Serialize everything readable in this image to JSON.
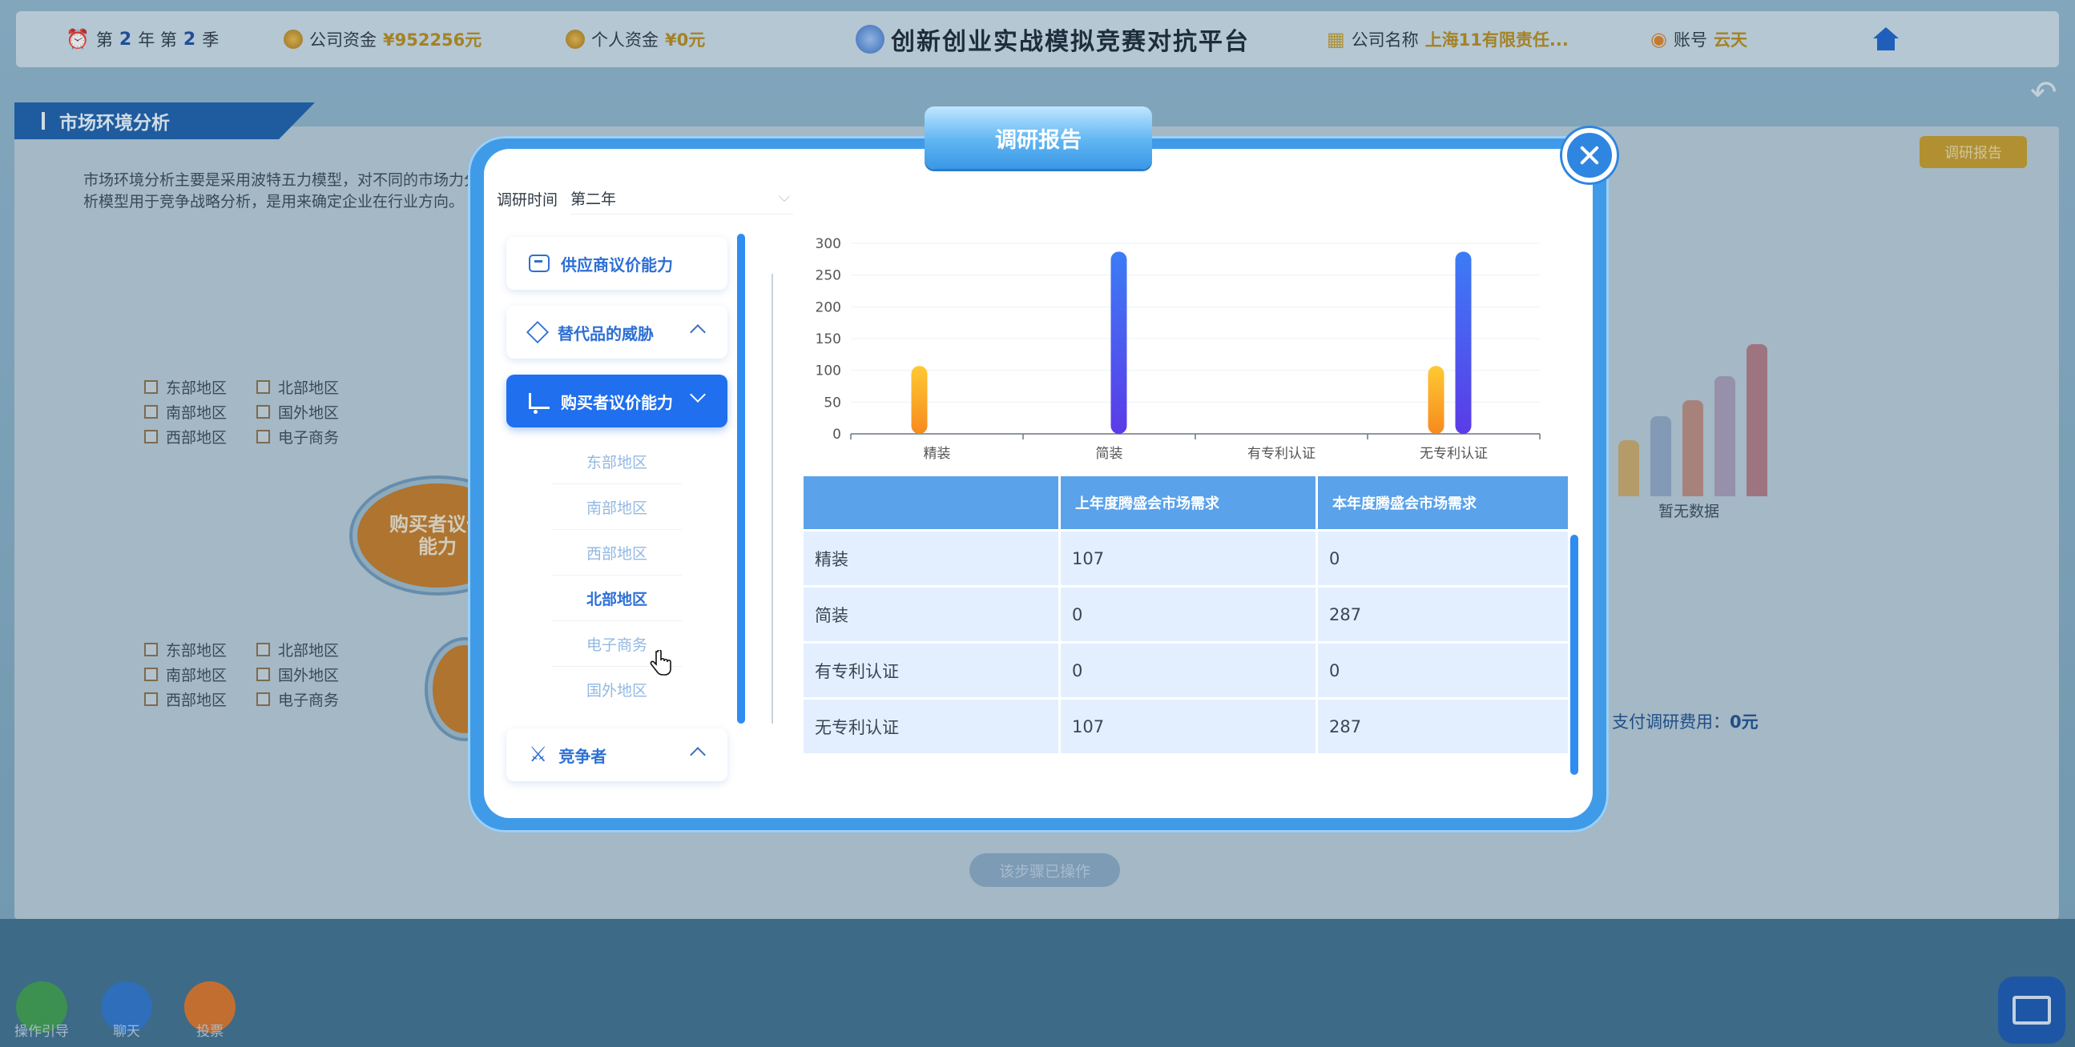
{
  "topbar": {
    "year_prefix": "第",
    "year": "2",
    "year_mid": "年 第",
    "season": "2",
    "season_suffix": "季",
    "company_funds_label": "公司资金",
    "company_funds_value": "¥952256元",
    "personal_funds_label": "个人资金",
    "personal_funds_value": "¥0元",
    "platform_title": "创新创业实战模拟竞赛对抗平台",
    "company_name_label": "公司名称",
    "company_name_value": "上海11有限责任...",
    "account_label": "账号",
    "account_value": "云天"
  },
  "background": {
    "section_title": "市场环境分析",
    "intro_text": "市场环境分析主要是采用波特五力模型，对不同的市场力分析模型用于竞争战略分析，是用来确定企业在行业方向。",
    "report_button": "调研报告",
    "regions_top": [
      "东部地区",
      "北部地区",
      "南部地区",
      "国外地区",
      "西部地区",
      "电子商务"
    ],
    "regions_bottom": [
      "东部地区",
      "北部地区",
      "南部地区",
      "国外地区",
      "西部地区",
      "电子商务"
    ],
    "circle_label": "购买者议价能力",
    "no_data": "暂无数据",
    "fee_label": "支付调研费用：",
    "fee_value": "0元",
    "step_button": "该步骤已操作"
  },
  "bottom": {
    "guide": "操作引导",
    "chat": "聊天",
    "vote": "投票"
  },
  "modal": {
    "title": "调研报告",
    "survey_time_label": "调研时间",
    "survey_time_value": "第二年",
    "nav": {
      "supplier": "供应商议价能力",
      "substitute": "替代品的威胁",
      "buyer": "购买者议价能力",
      "competitor": "竞争者",
      "sub_items": [
        "东部地区",
        "南部地区",
        "西部地区",
        "北部地区",
        "电子商务",
        "国外地区"
      ],
      "current_sub_index": 3
    },
    "table": {
      "headers": [
        "",
        "上年度腾盛会市场需求",
        "本年度腾盛会市场需求"
      ],
      "rows": [
        [
          "精装",
          "107",
          "0"
        ],
        [
          "简装",
          "0",
          "287"
        ],
        [
          "有专利认证",
          "0",
          "0"
        ],
        [
          "无专利认证",
          "107",
          "287"
        ]
      ]
    }
  },
  "chart_data": {
    "type": "bar",
    "categories": [
      "精装",
      "简装",
      "有专利认证",
      "无专利认证"
    ],
    "series": [
      {
        "values": [
          107,
          0,
          0,
          107
        ],
        "color": "#f7a21b"
      },
      {
        "values": [
          0,
          287,
          0,
          287
        ],
        "color": "#3f5ff0"
      }
    ],
    "ylim": [
      0,
      300
    ],
    "yticks": [
      0,
      50,
      100,
      150,
      200,
      250,
      300
    ]
  }
}
